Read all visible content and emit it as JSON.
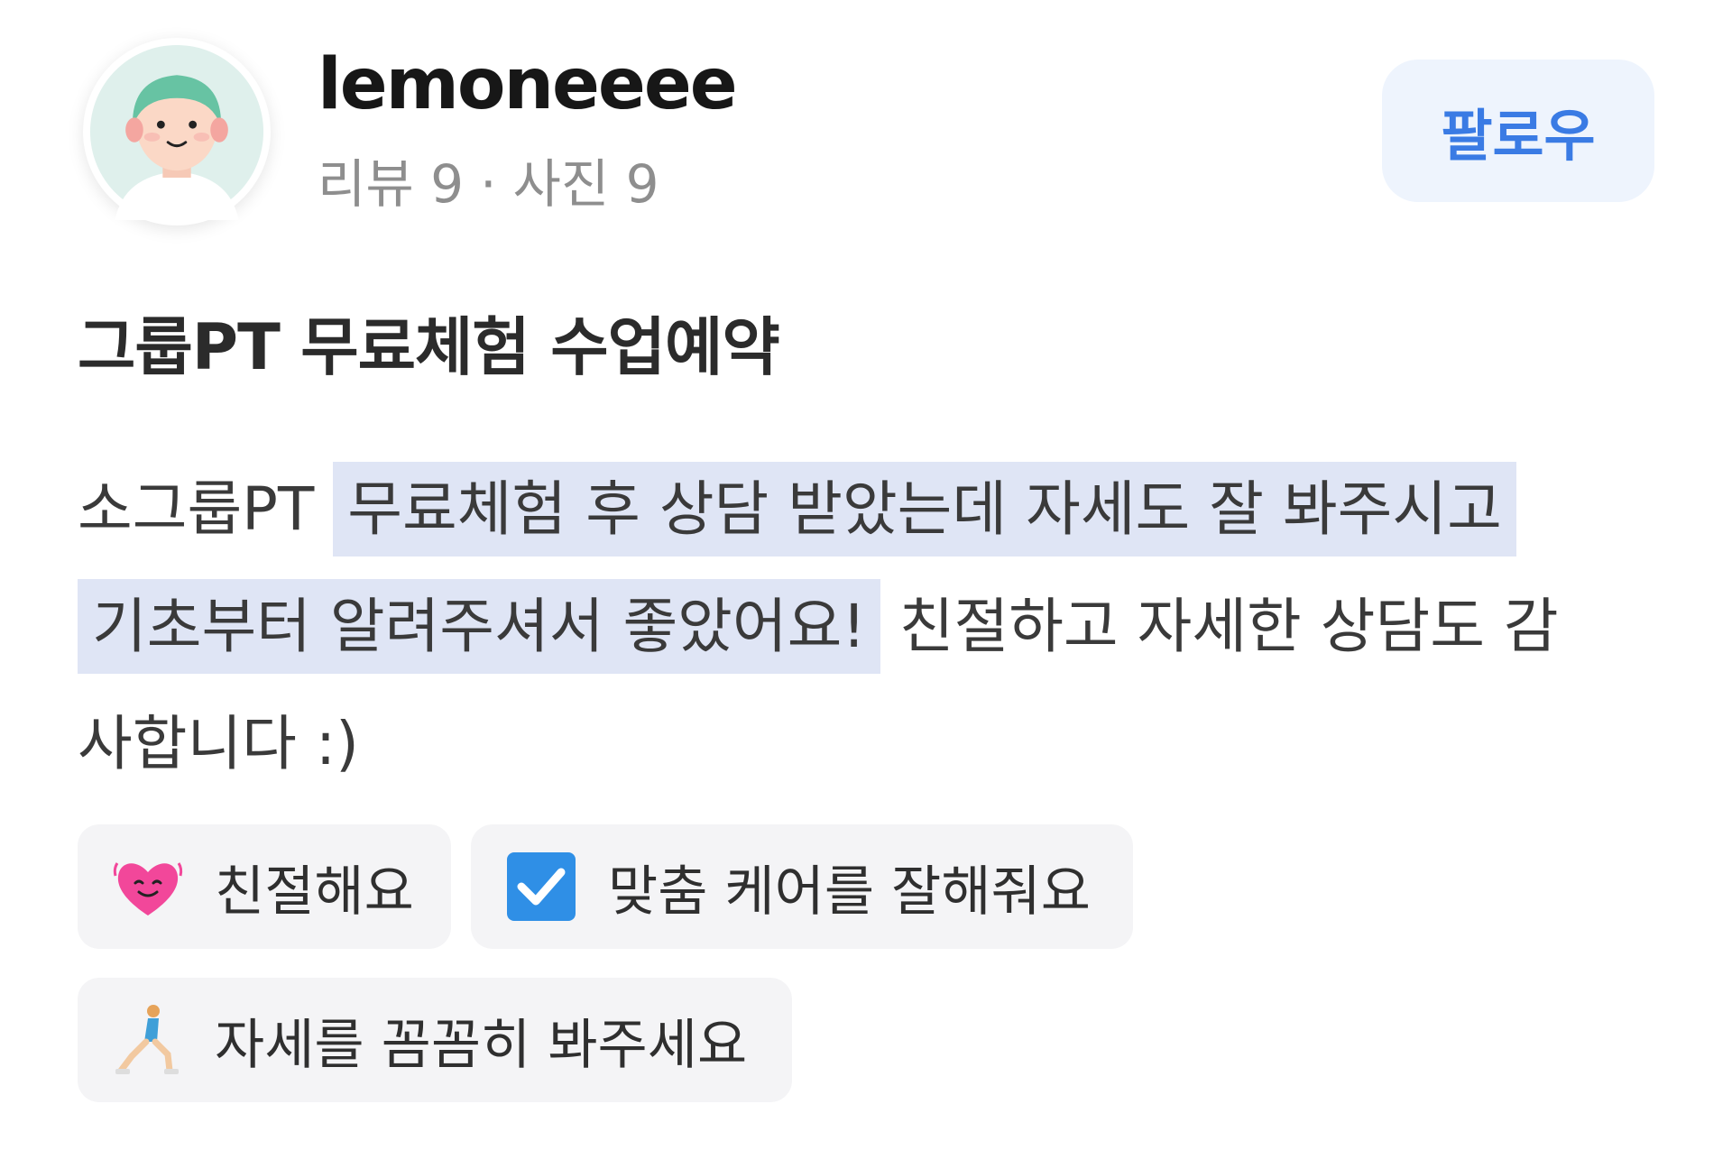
{
  "profile": {
    "username": "lemoneeee",
    "reviews": "리뷰 9",
    "separator": "·",
    "photos": "사진 9",
    "follow_label": "팔로우"
  },
  "post": {
    "title": "그룹PT 무료체험 수업예약",
    "review_lines": [
      {
        "plain": "소그룹PT ",
        "highlight": "무료체험 후 상담 받았는데 자세도 잘 봐주시고",
        "tail": ""
      },
      {
        "plain": "",
        "highlight": "기초부터 알려주셔서 좋았어요!",
        "tail": " 친절하고 자세한 상담도 감"
      },
      {
        "plain": "사합니다 :)",
        "highlight": "",
        "tail": ""
      }
    ]
  },
  "tags": [
    {
      "icon": "heart-face-icon",
      "label": "친절해요"
    },
    {
      "icon": "checkbox-icon",
      "label": "맞춤 케어를 잘해줘요"
    },
    {
      "icon": "lunge-person-icon",
      "label": "자세를 꼼꼼히 봐주세요"
    }
  ],
  "colors": {
    "follow_bg": "#eef4fd",
    "follow_text": "#3a7be4",
    "highlight": "#dfe5f5",
    "tag_bg": "#f4f4f6",
    "meta_text": "#8e8e8e"
  }
}
